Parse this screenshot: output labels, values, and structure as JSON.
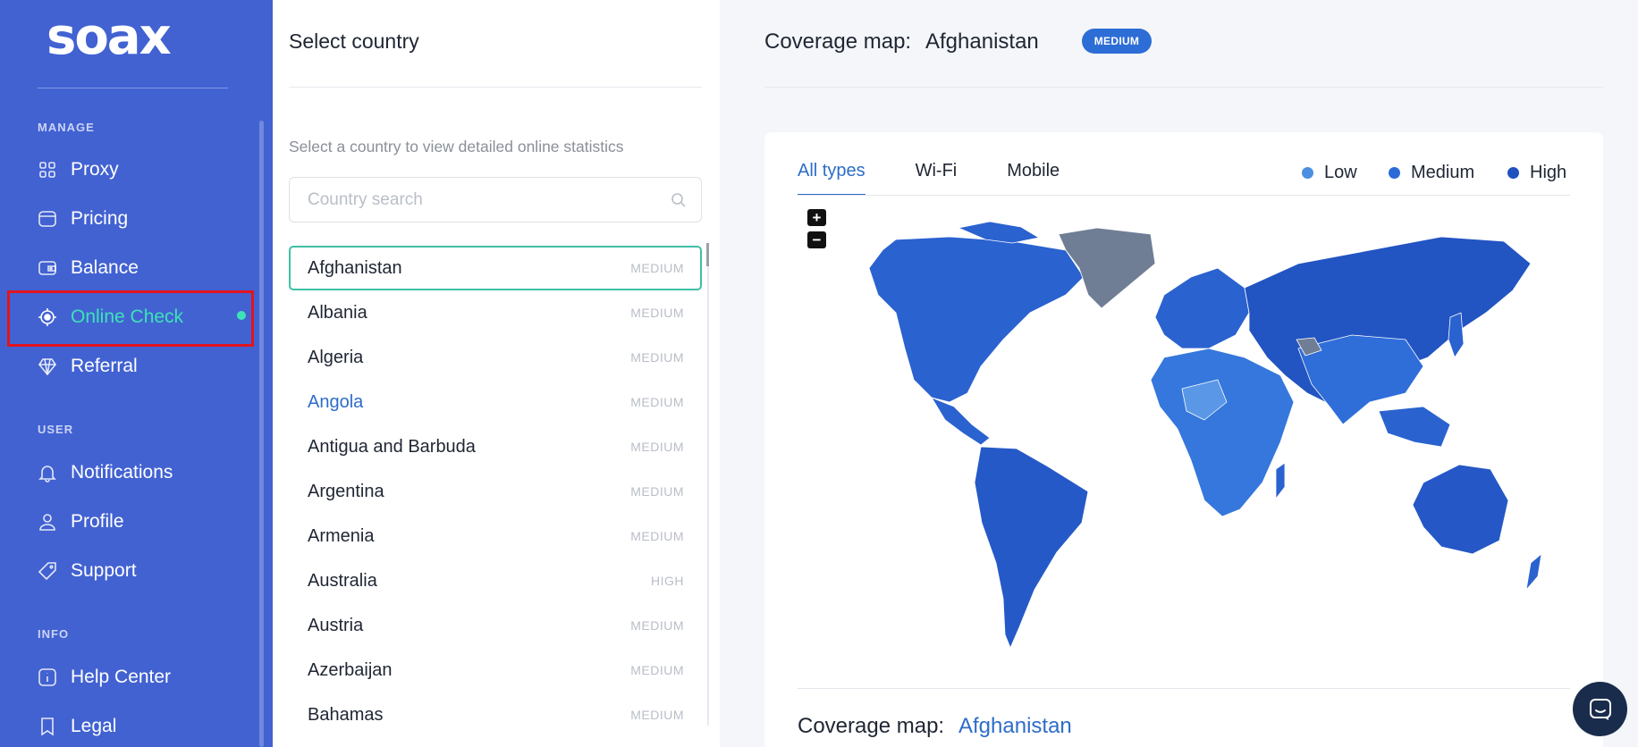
{
  "brand": {
    "logo": "soax"
  },
  "sidebar": {
    "sections": {
      "manage": "MANAGE",
      "user": "USER",
      "info": "INFO"
    },
    "items": [
      {
        "label": "Proxy",
        "icon": "grid-icon"
      },
      {
        "label": "Pricing",
        "icon": "tag-icon"
      },
      {
        "label": "Balance",
        "icon": "wallet-icon"
      },
      {
        "label": "Online Check",
        "icon": "target-icon",
        "active": true
      },
      {
        "label": "Referral",
        "icon": "diamond-icon"
      },
      {
        "label": "Notifications",
        "icon": "bell-icon"
      },
      {
        "label": "Profile",
        "icon": "user-icon"
      },
      {
        "label": "Support",
        "icon": "ticket-icon"
      },
      {
        "label": "Help Center",
        "icon": "info-icon"
      },
      {
        "label": "Legal",
        "icon": "bookmark-icon"
      }
    ]
  },
  "country_panel": {
    "title": "Select country",
    "hint": "Select a country to view detailed online statistics",
    "search_placeholder": "Country search",
    "countries": [
      {
        "name": "Afghanistan",
        "level": "MEDIUM"
      },
      {
        "name": "Albania",
        "level": "MEDIUM"
      },
      {
        "name": "Algeria",
        "level": "MEDIUM"
      },
      {
        "name": "Angola",
        "level": "MEDIUM"
      },
      {
        "name": "Antigua and Barbuda",
        "level": "MEDIUM"
      },
      {
        "name": "Argentina",
        "level": "MEDIUM"
      },
      {
        "name": "Armenia",
        "level": "MEDIUM"
      },
      {
        "name": "Australia",
        "level": "HIGH"
      },
      {
        "name": "Austria",
        "level": "MEDIUM"
      },
      {
        "name": "Azerbaijan",
        "level": "MEDIUM"
      },
      {
        "name": "Bahamas",
        "level": "MEDIUM"
      }
    ]
  },
  "main": {
    "header_label": "Coverage map:",
    "header_country": "Afghanistan",
    "badge": "MEDIUM",
    "tabs": [
      "All types",
      "Wi-Fi",
      "Mobile"
    ],
    "legend": [
      {
        "label": "Low",
        "color": "#4a8fe0"
      },
      {
        "label": "Medium",
        "color": "#2a6ad6"
      },
      {
        "label": "High",
        "color": "#1f52bf"
      }
    ],
    "zoom_in": "+",
    "zoom_out": "−",
    "bottom_label": "Coverage map:",
    "bottom_country": "Afghanistan"
  }
}
